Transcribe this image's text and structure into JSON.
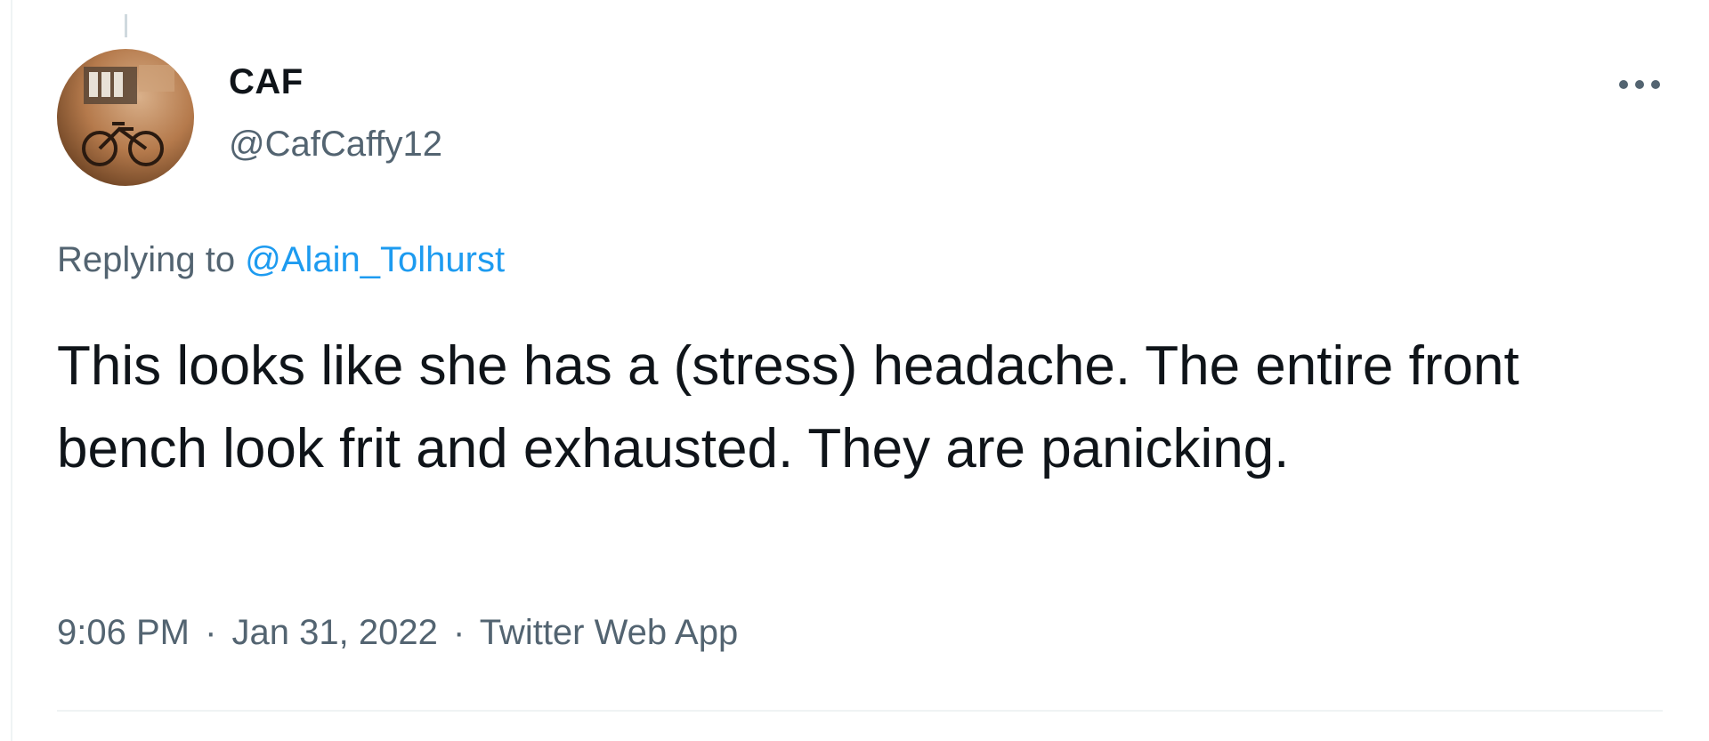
{
  "tweet": {
    "author": {
      "display_name": "CAF",
      "handle": "@CafCaffy12",
      "avatar_icon": "profile-photo-bicycle"
    },
    "reply": {
      "prefix": "Replying to",
      "mention": "@Alain_Tolhurst"
    },
    "text": "This looks like she has a (stress) headache. The entire front bench look frit and exhausted. They are panicking.",
    "meta": {
      "time": "9:06 PM",
      "separator": "·",
      "date": "Jan 31, 2022",
      "source": "Twitter Web App"
    },
    "more_icon": "more-horizontal-icon"
  },
  "colors": {
    "text_primary": "#0f1419",
    "text_secondary": "#536471",
    "link": "#1d9bf0",
    "divider": "#eff3f4"
  }
}
